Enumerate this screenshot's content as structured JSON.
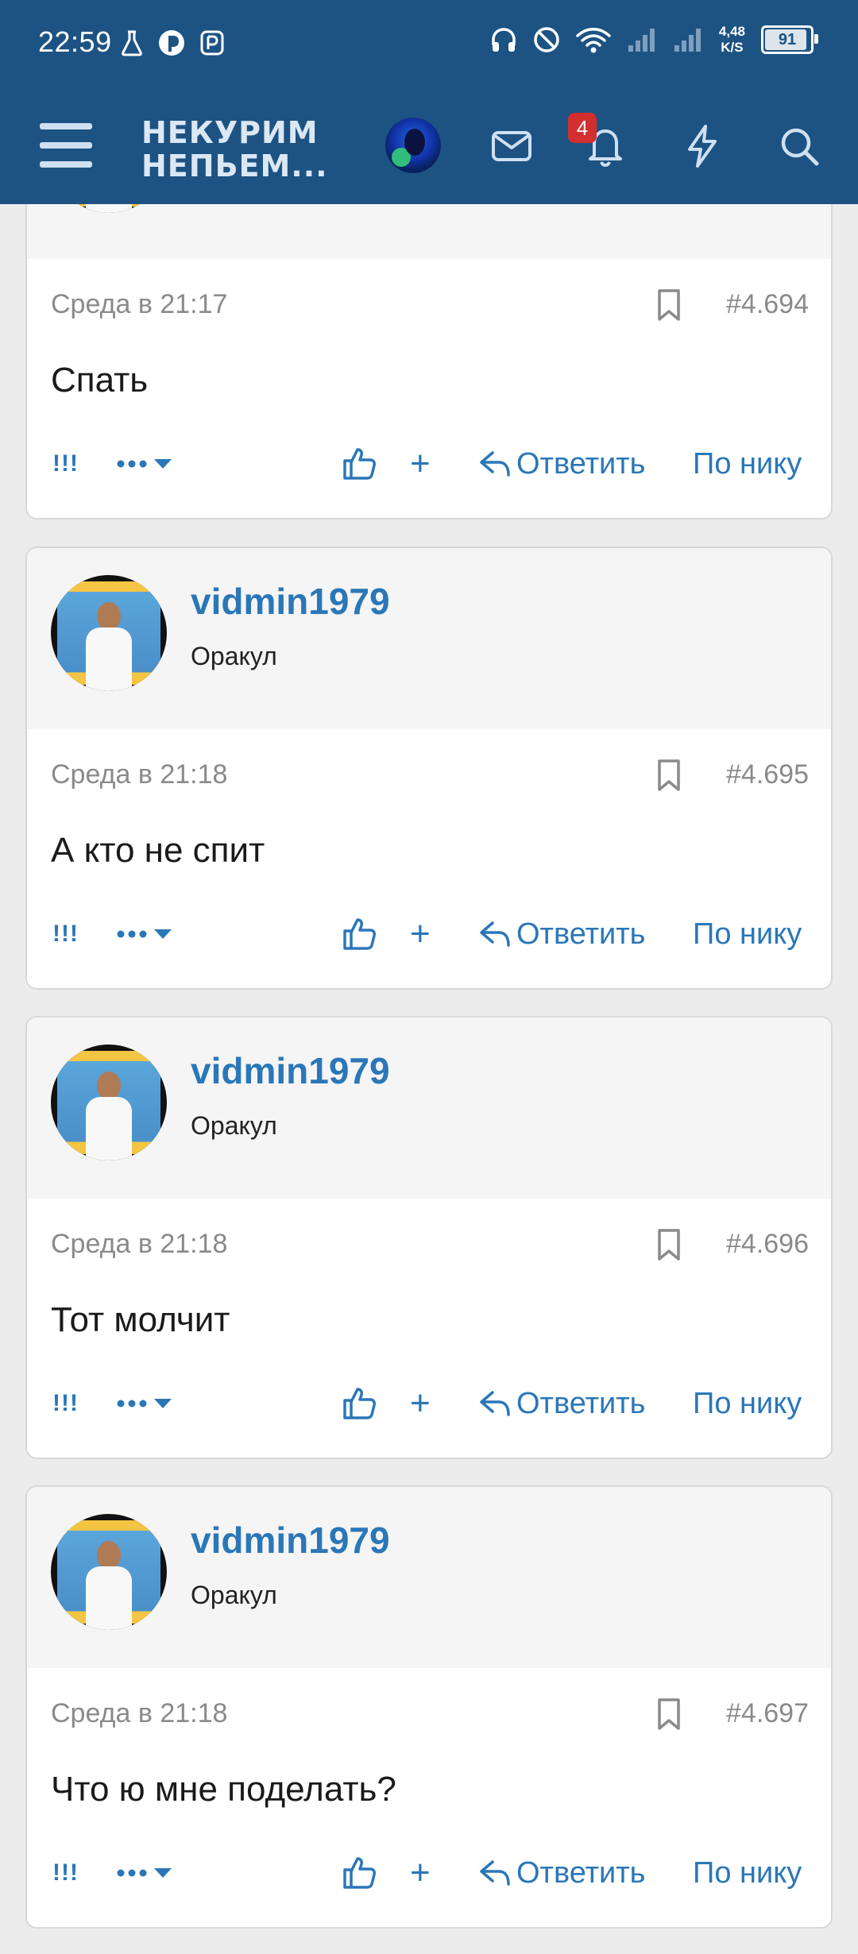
{
  "status_bar": {
    "time": "22:59",
    "net_speed_value": "4,48",
    "net_speed_unit": "K/S",
    "battery": "91"
  },
  "app_header": {
    "logo_line1": "НЕКУРИМ",
    "logo_line2": "НЕПЬЕМ...",
    "notifications_count": "4"
  },
  "actions_labels": {
    "report": "!!!",
    "reply": "Ответить",
    "by_nick": "По нику",
    "plus": "+"
  },
  "posts": [
    {
      "date": "Среда в 21:17",
      "number": "#4.694",
      "text": "Спать"
    },
    {
      "author": "vidmin1979",
      "rank": "Оракул",
      "date": "Среда в 21:18",
      "number": "#4.695",
      "text": "А кто не спит"
    },
    {
      "author": "vidmin1979",
      "rank": "Оракул",
      "date": "Среда в 21:18",
      "number": "#4.696",
      "text": "Тот молчит"
    },
    {
      "author": "vidmin1979",
      "rank": "Оракул",
      "date": "Среда в 21:18",
      "number": "#4.697",
      "text": "Что ю мне поделать?"
    }
  ],
  "colors": {
    "header_bg": "#1d5383",
    "link": "#2a77b8",
    "badge": "#d32f2f"
  }
}
